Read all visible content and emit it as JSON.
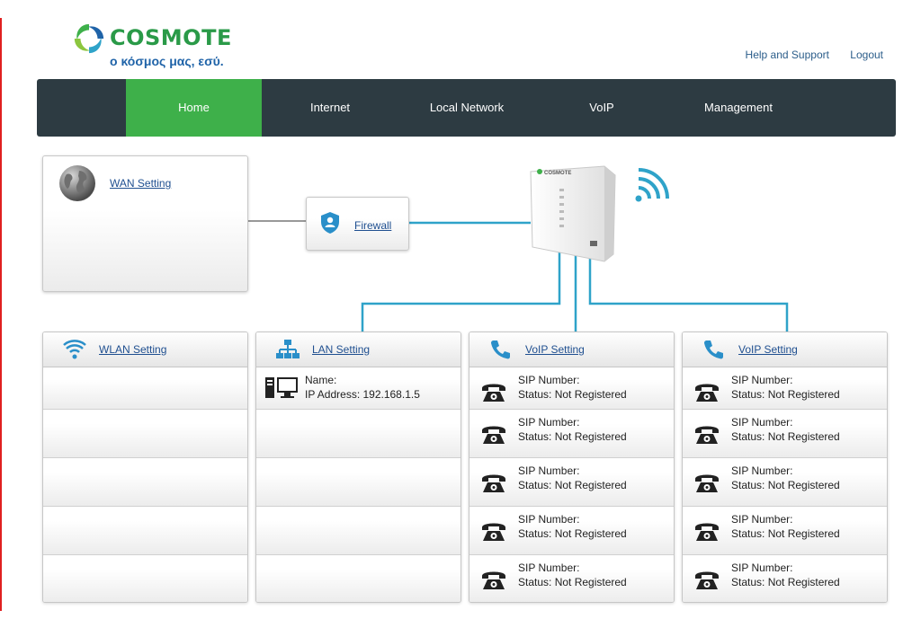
{
  "brand": {
    "name": "COSMOTE",
    "tagline": "ο κόσμος μας, εσύ."
  },
  "header": {
    "help_label": "Help and Support",
    "logout_label": "Logout"
  },
  "nav": {
    "items": [
      {
        "label": "Home",
        "active": true
      },
      {
        "label": "Internet",
        "active": false
      },
      {
        "label": "Local Network",
        "active": false
      },
      {
        "label": "VoIP",
        "active": false
      },
      {
        "label": "Management",
        "active": false
      }
    ]
  },
  "topology": {
    "wan_label": "WAN Setting",
    "firewall_label": "Firewall",
    "router_brand": "COSMOTE"
  },
  "wlan": {
    "title": "WLAN Setting"
  },
  "lan": {
    "title": "LAN Setting",
    "devices": [
      {
        "name_line": "Name:",
        "ip_line": "IP Address: 192.168.1.5"
      }
    ]
  },
  "voip1": {
    "title": "VoIP Setting",
    "lines": [
      {
        "sip": "SIP Number:",
        "status": "Status: Not Registered"
      },
      {
        "sip": "SIP Number:",
        "status": "Status: Not Registered"
      },
      {
        "sip": "SIP Number:",
        "status": "Status: Not Registered"
      },
      {
        "sip": "SIP Number:",
        "status": "Status: Not Registered"
      },
      {
        "sip": "SIP Number:",
        "status": "Status: Not Registered"
      }
    ]
  },
  "voip2": {
    "title": "VoIP Setting",
    "lines": [
      {
        "sip": "SIP Number:",
        "status": "Status: Not Registered"
      },
      {
        "sip": "SIP Number:",
        "status": "Status: Not Registered"
      },
      {
        "sip": "SIP Number:",
        "status": "Status: Not Registered"
      },
      {
        "sip": "SIP Number:",
        "status": "Status: Not Registered"
      },
      {
        "sip": "SIP Number:",
        "status": "Status: Not Registered"
      }
    ]
  },
  "colors": {
    "nav_bg": "#2d3b42",
    "nav_active": "#3eb04a",
    "link": "#1f4f90",
    "connector": "#2fa3c9"
  }
}
